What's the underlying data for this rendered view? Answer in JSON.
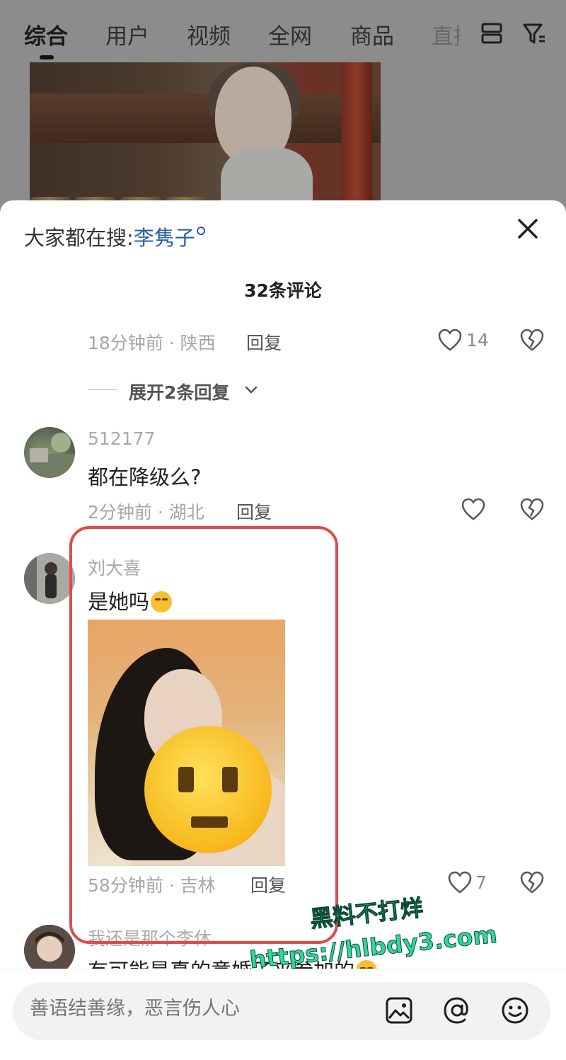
{
  "tabs": [
    "综合",
    "用户",
    "视频",
    "全网",
    "商品",
    "直播"
  ],
  "trending": {
    "prefix": "大家都在搜:",
    "keyword": "李隽子"
  },
  "comments_header": "32条评论",
  "first_comment_meta": {
    "time_loc": "18分钟前 · 陕西",
    "reply": "回复",
    "likes": "14"
  },
  "expand_replies": "展开2条回复",
  "comments": [
    {
      "user": "512177",
      "text": "都在降级么?",
      "time_loc": "2分钟前 · 湖北",
      "reply": "回复",
      "likes": ""
    },
    {
      "user": "刘大喜",
      "text": "是她吗",
      "time_loc": "58分钟前 · 吉林",
      "reply": "回复",
      "likes": "7"
    },
    {
      "user": "我还是那个李休",
      "text": "有可能是真的意婚子来参加的"
    }
  ],
  "watermark": {
    "line1": "黑料不打烊",
    "line2": "https://hlbdy3.com"
  },
  "input": {
    "placeholder": "善语结善缘，恶言伤人心"
  },
  "colors": {
    "keyword": "#2b5fa8",
    "highlight": "#e04a4a",
    "watermark": "#31d69a"
  }
}
